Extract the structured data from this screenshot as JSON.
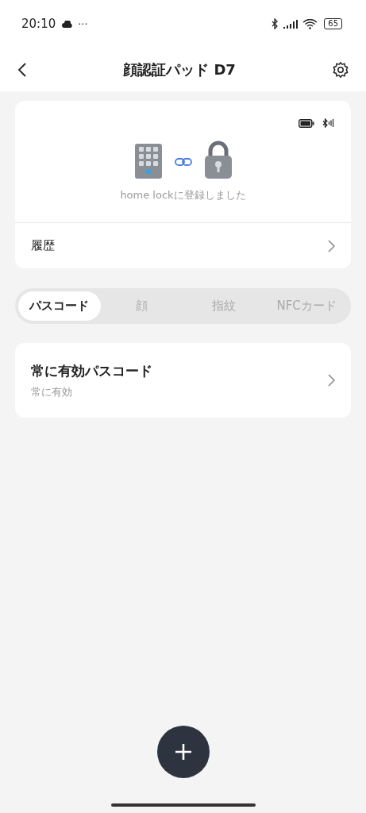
{
  "status_bar": {
    "time": "20:10",
    "more": "···",
    "battery": "65"
  },
  "header": {
    "title": "顔認証パッド D7"
  },
  "device_card": {
    "status": "home lockに登録しました",
    "history_label": "履歴"
  },
  "tabs": [
    {
      "label": "パスコード",
      "selected": true
    },
    {
      "label": "顔",
      "selected": false
    },
    {
      "label": "指紋",
      "selected": false
    },
    {
      "label": "NFCカード",
      "selected": false
    }
  ],
  "passcodes": [
    {
      "title": "常に有効パスコード",
      "subtitle": "常に有効"
    }
  ]
}
